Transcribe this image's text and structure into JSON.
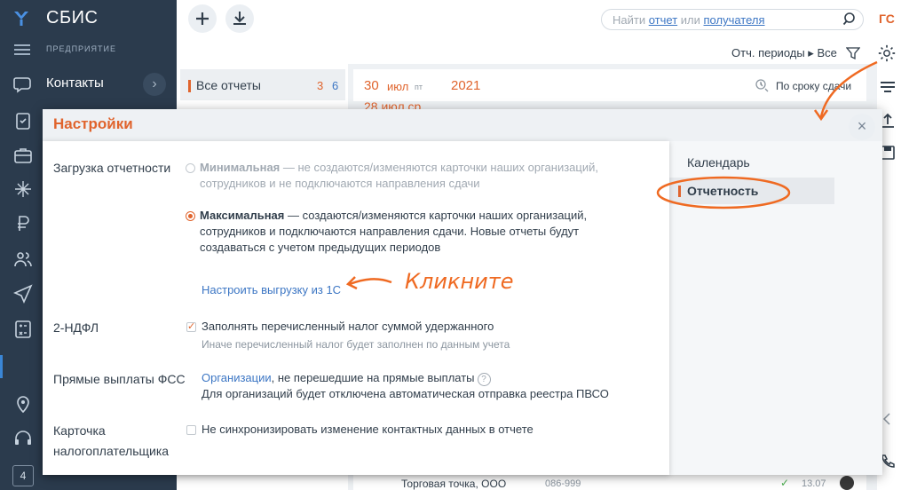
{
  "app": {
    "brand": "СБИС",
    "org": "ПРЕДПРИЯТИЕ",
    "user_initials": "ГС",
    "bottom_badge": "4"
  },
  "sidebar": {
    "contacts_label": "Контакты",
    "icons": [
      "chat-icon",
      "clipboard-icon",
      "briefcase-icon",
      "sparkle-icon",
      "ruble-icon",
      "people-icon",
      "send-icon",
      "calculator-icon",
      "map-pin-icon",
      "headset-icon"
    ]
  },
  "search": {
    "prefix": "Найти ",
    "link1": "отчет",
    "mid": " или ",
    "link2": "получателя"
  },
  "filter": {
    "label": "Отч. периоды ▸ Все"
  },
  "reports_nav": {
    "title": "Все отчеты",
    "count_orange": "3",
    "count_blue": "6"
  },
  "date_header": {
    "day": "30",
    "month": "июл",
    "weekday": "пт",
    "year": "2021",
    "sort_label": "По сроку сдачи"
  },
  "date_row2": {
    "text": "28  июл  ср"
  },
  "bottom_row": {
    "name": "Торговая точка, ООО",
    "code": "086-999",
    "date": "13.07"
  },
  "dialog": {
    "title": "Настройки",
    "close": "×",
    "tabs": [
      {
        "label": "Календарь"
      },
      {
        "label": "Отчетность"
      }
    ],
    "sections": {
      "upload": {
        "label": "Загрузка отчетности",
        "min_title": "Минимальная",
        "min_desc_1": " — не создаются/изменяются карточки наших организаций,",
        "min_desc_2": "сотрудников и не подключаются направления сдачи",
        "max_title": "Максимальная",
        "max_desc_1": " — создаются/изменяются карточки наших организаций,",
        "max_desc_2": "сотрудников и подключаются направления сдачи. Новые отчеты будут",
        "max_desc_3": "создаваться с учетом предыдущих периодов",
        "link_1c": "Настроить выгрузку из 1С"
      },
      "ndfl": {
        "label": "2-НДФЛ",
        "checkbox_label": "Заполнять перечисленный налог суммой удержанного",
        "hint": "Иначе перечисленный налог будет заполнен по данным учета"
      },
      "fss": {
        "label": "Прямые выплаты ФСС",
        "link": "Организации",
        "text": ", не перешедшие на прямые выплаты",
        "hint": "Для организаций будет отключена автоматическая отправка реестра ПВСО",
        "help": "?"
      },
      "card": {
        "label_1": "Карточка",
        "label_2": "налогоплательщика",
        "checkbox_label": "Не синхронизировать изменение контактных данных в отчете"
      }
    }
  },
  "annotation": {
    "text": "Кликните",
    "color": "#ef6a22"
  },
  "colors": {
    "accent": "#e0642d",
    "link": "#3c76c4",
    "sidebar_bg": "#2b3b4d"
  }
}
